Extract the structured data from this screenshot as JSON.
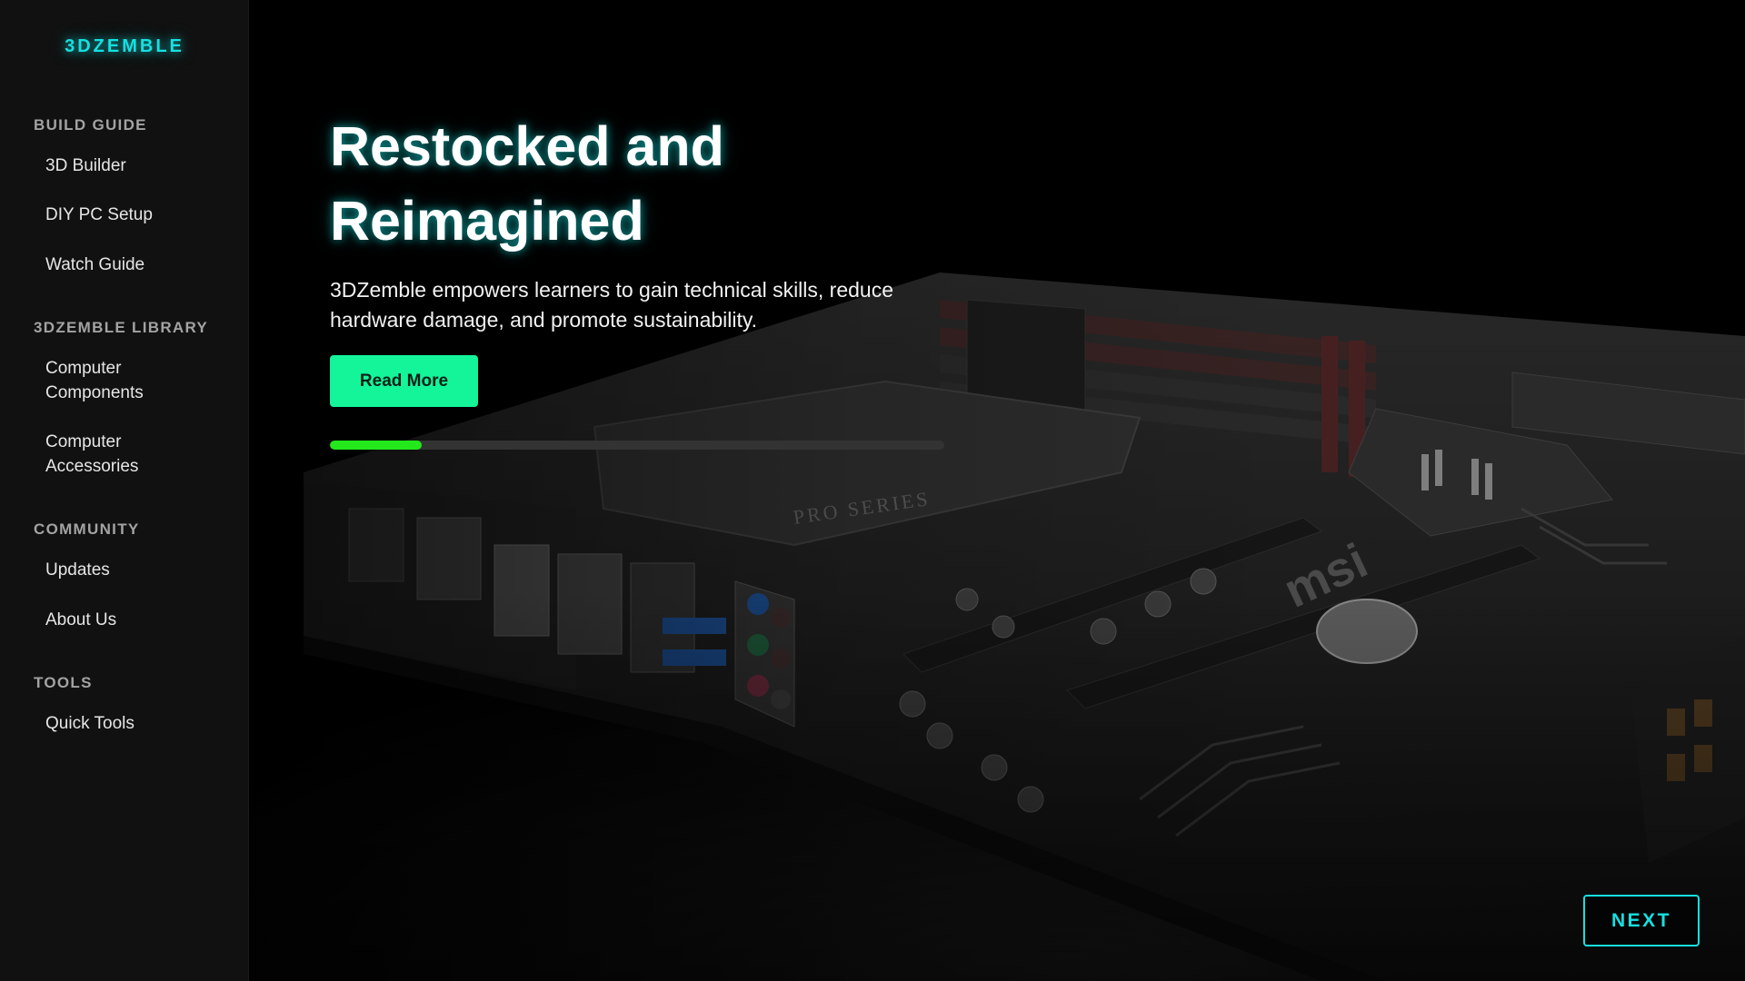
{
  "brand": {
    "name": "3DZEMBLE"
  },
  "sidebar": {
    "sections": [
      {
        "heading": "BUILD GUIDE",
        "items": [
          {
            "label": "3D Builder"
          },
          {
            "label": "DIY PC Setup"
          },
          {
            "label": "Watch Guide"
          }
        ]
      },
      {
        "heading": "3DZEMBLE LIBRARY",
        "items": [
          {
            "label": "Computer Components"
          },
          {
            "label": "Computer Accessories"
          }
        ]
      },
      {
        "heading": "COMMUNITY",
        "items": [
          {
            "label": "Updates"
          },
          {
            "label": "About Us"
          }
        ]
      },
      {
        "heading": "TOOLS",
        "items": [
          {
            "label": "Quick Tools"
          }
        ]
      }
    ]
  },
  "hero": {
    "title": "Restocked and Reimagined",
    "description": "3DZemble empowers learners to gain technical skills, reduce hardware damage, and promote sustainability.",
    "cta_label": "Read More",
    "slide_progress": 0.15,
    "background_icon": "motherboard-image",
    "board_print": {
      "series": "PRO SERIES",
      "brand": "msi"
    }
  },
  "carousel": {
    "next_label": "NEXT"
  },
  "colors": {
    "accent_cyan": "#16e0e0",
    "cta_green": "#14f59a",
    "progress_green": "#23e81c",
    "sidebar_bg": "#111111",
    "hero_bg": "#000000"
  }
}
